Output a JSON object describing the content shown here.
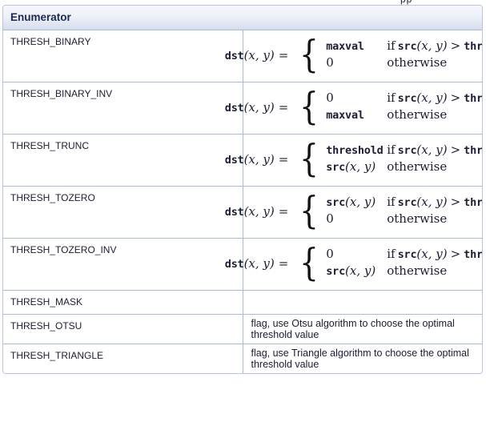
{
  "page": {
    "clipped_text_above": "pp",
    "accent_border": "#a9bad8",
    "header_text_color": "#1b2a52"
  },
  "table": {
    "header": "Enumerator",
    "rows": [
      {
        "name": "THRESH_BINARY",
        "type": "formula",
        "formula": {
          "lhs_fn": "dst",
          "lhs_args": "(x, y)",
          "equals": "=",
          "cases": [
            {
              "value_text": "maxval",
              "value_style": "mono",
              "cond_if": "if",
              "cond_fn": "src",
              "cond_args": "(x, y)",
              "cond_op": ">",
              "cond_rhs": "thresh"
            },
            {
              "value_text": "0",
              "value_style": "serif",
              "cond_otherwise": "otherwise"
            }
          ]
        }
      },
      {
        "name": "THRESH_BINARY_INV",
        "type": "formula",
        "formula": {
          "lhs_fn": "dst",
          "lhs_args": "(x, y)",
          "equals": "=",
          "cases": [
            {
              "value_text": "0",
              "value_style": "serif",
              "cond_if": "if",
              "cond_fn": "src",
              "cond_args": "(x, y)",
              "cond_op": ">",
              "cond_rhs": "thresh"
            },
            {
              "value_text": "maxval",
              "value_style": "mono",
              "cond_otherwise": "otherwise"
            }
          ]
        }
      },
      {
        "name": "THRESH_TRUNC",
        "type": "formula",
        "formula": {
          "lhs_fn": "dst",
          "lhs_args": "(x, y)",
          "equals": "=",
          "cases": [
            {
              "value_text": "threshold",
              "value_style": "mono",
              "cond_if": "if",
              "cond_fn": "src",
              "cond_args": "(x, y)",
              "cond_op": ">",
              "cond_rhs": "thresh"
            },
            {
              "value_fn": "src",
              "value_args": "(x, y)",
              "value_style": "fn",
              "cond_otherwise": "otherwise"
            }
          ]
        }
      },
      {
        "name": "THRESH_TOZERO",
        "type": "formula",
        "formula": {
          "lhs_fn": "dst",
          "lhs_args": "(x, y)",
          "equals": "=",
          "cases": [
            {
              "value_fn": "src",
              "value_args": "(x, y)",
              "value_style": "fn",
              "cond_if": "if",
              "cond_fn": "src",
              "cond_args": "(x, y)",
              "cond_op": ">",
              "cond_rhs": "thresh"
            },
            {
              "value_text": "0",
              "value_style": "serif",
              "cond_otherwise": "otherwise"
            }
          ]
        }
      },
      {
        "name": "THRESH_TOZERO_INV",
        "type": "formula",
        "formula": {
          "lhs_fn": "dst",
          "lhs_args": "(x, y)",
          "equals": "=",
          "cases": [
            {
              "value_text": "0",
              "value_style": "serif",
              "cond_if": "if",
              "cond_fn": "src",
              "cond_args": "(x, y)",
              "cond_op": ">",
              "cond_rhs": "thresh"
            },
            {
              "value_fn": "src",
              "value_args": "(x, y)",
              "value_style": "fn",
              "cond_otherwise": "otherwise"
            }
          ]
        }
      },
      {
        "name": "THRESH_MASK",
        "type": "text",
        "description": ""
      },
      {
        "name": "THRESH_OTSU",
        "type": "text",
        "description": "flag, use Otsu algorithm to choose the optimal threshold value"
      },
      {
        "name": "THRESH_TRIANGLE",
        "type": "text",
        "description": "flag, use Triangle algorithm to choose the optimal threshold value"
      }
    ]
  }
}
